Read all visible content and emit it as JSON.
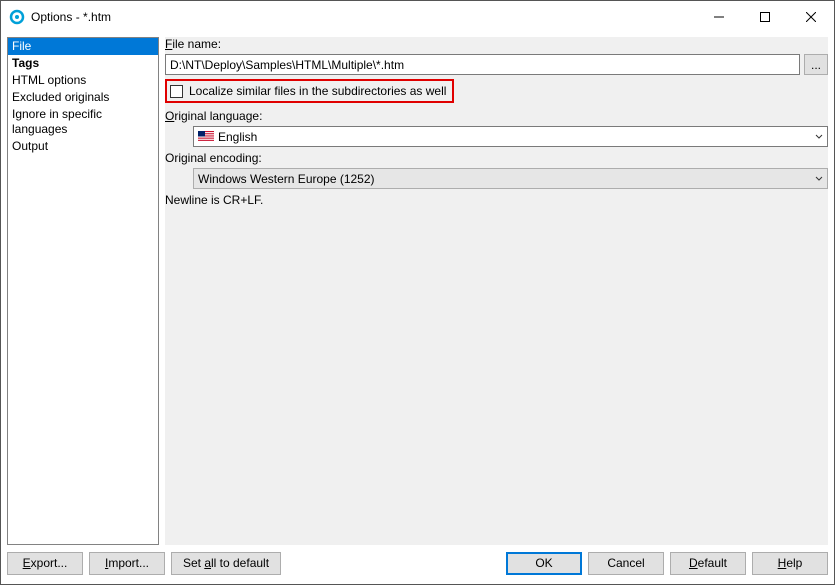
{
  "window": {
    "title": "Options - *.htm"
  },
  "sidebar": {
    "items": [
      {
        "label": "File",
        "selected": true,
        "bold": false
      },
      {
        "label": "Tags",
        "selected": false,
        "bold": true
      },
      {
        "label": "HTML options",
        "selected": false,
        "bold": false
      },
      {
        "label": "Excluded originals",
        "selected": false,
        "bold": false
      },
      {
        "label": "Ignore in specific languages",
        "selected": false,
        "bold": false
      },
      {
        "label": "Output",
        "selected": false,
        "bold": false
      }
    ]
  },
  "main": {
    "filename_label": "File name:",
    "filename_value": "D:\\NT\\Deploy\\Samples\\HTML\\Multiple\\*.htm",
    "browse_label": "...",
    "localize_checkbox_label": "Localize similar files in the subdirectories as well",
    "original_language_label": "Original language:",
    "original_language_value": "English",
    "original_encoding_label": "Original encoding:",
    "original_encoding_value": "Windows Western Europe (1252)",
    "newline_text": "Newline is CR+LF."
  },
  "buttons": {
    "export": "Export...",
    "import": "Import...",
    "set_all": "Set all to default",
    "ok": "OK",
    "cancel": "Cancel",
    "default": "Default",
    "help": "Help"
  }
}
